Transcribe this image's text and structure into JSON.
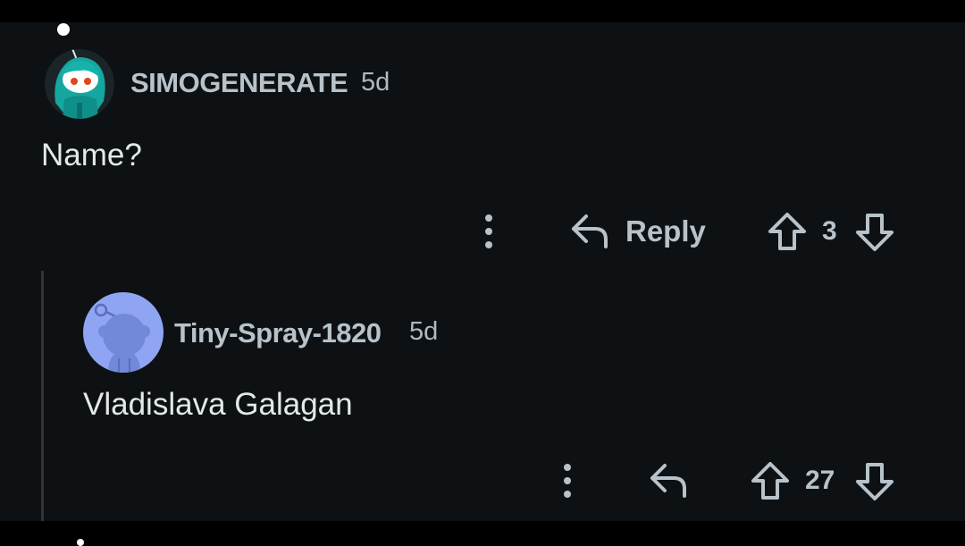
{
  "colors": {
    "background": "#0e1113",
    "frame": "#000000",
    "username": "#b7c2ca",
    "text": "#e3e8ea",
    "thread_line": "#2e3437",
    "avatar2_bg": "#8fa5f4"
  },
  "comments": [
    {
      "username": "SIMOGENERATE",
      "time": "5d",
      "body": "Name?",
      "avatar_icon": "snoo-avatar-teal-hair",
      "actions": {
        "more_icon": "more-vertical-icon",
        "reply_icon": "reply-arrow-icon",
        "reply_label": "Reply",
        "upvote_icon": "upvote-arrow-icon",
        "score": "3",
        "downvote_icon": "downvote-arrow-icon"
      }
    },
    {
      "username": "Tiny-Spray-1820",
      "time": "5d",
      "body": "Vladislava Galagan",
      "avatar_icon": "default-snoo-avatar",
      "actions": {
        "more_icon": "more-vertical-icon",
        "reply_icon": "reply-arrow-icon",
        "upvote_icon": "upvote-arrow-icon",
        "score": "27",
        "downvote_icon": "downvote-arrow-icon"
      }
    }
  ]
}
